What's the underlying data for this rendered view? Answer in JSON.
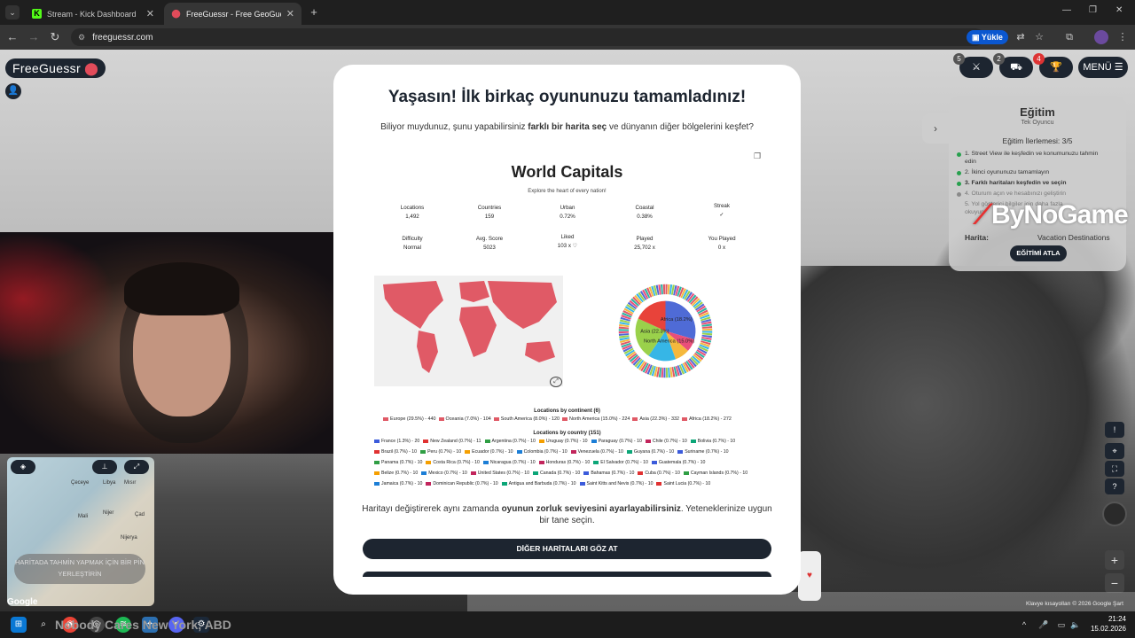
{
  "browser": {
    "tabs": [
      {
        "label": "Stream - Kick Dashboard",
        "icon": "kick-icon",
        "active": false
      },
      {
        "label": "FreeGuessr - Free GeoGuessr Al",
        "icon": "freeguessr-pin-icon",
        "active": true
      }
    ],
    "url": "freeguessr.com",
    "translate_label": "Yükle"
  },
  "game": {
    "logo": "FreeGuessr",
    "badges": {
      "multiplayer": "5",
      "party": "2",
      "trophy": "4"
    },
    "menu_label": "MENÜ",
    "credits": "Klavye kısayolları  © 2026 Google  Şart"
  },
  "tutorial": {
    "title": "Eğitim",
    "subtitle": "Tek Oyuncu",
    "progress": "Eğitim İlerlemesi: 3/5",
    "steps": [
      "1. Street View ile keşfedin ve konumunuzu tahmin edin",
      "2. İkinci oyununuzu tamamlayın",
      "3. Farklı haritaları keşfedin ve seçin",
      "4. Oturum açın ve hesabınızı geliştirin",
      "5. Yol gösterici bilgiler için daha fazla okuyun"
    ],
    "map_label": "Harita:",
    "map_value": "Vacation Destinations",
    "skip_label": "EĞİTİMİ ATLA"
  },
  "overlay_brand": "ByNoGame",
  "minimap": {
    "place_button": "HARİTADA TAHMİN YAPMAK İÇİN BİR PİN YERLEŞTİRİN",
    "google": "Google",
    "labels": [
      "Çeceye",
      "Libya",
      "Mısır",
      "Nijer",
      "Çad",
      "Mali",
      "Nijerya"
    ]
  },
  "modal": {
    "title": "Yaşasın! İlk birkaç oyununuzu tamamladınız!",
    "hint_pre": "Biliyor muydunuz, şunu yapabilirsiniz ",
    "hint_bold": "farklı bir harita seç",
    "hint_post": " ve dünyanın diğer bölgelerini keşfet?",
    "difficulty_pre": "Haritayı değiştirerek aynı zamanda ",
    "difficulty_bold": "oyunun zorluk seviyesini ayarlayabilirsiniz",
    "difficulty_post": ". Yeteneklerinize uygun bir tane seçin.",
    "browse_button": "DİĞER HARİTALARI GÖZ AT"
  },
  "map_card": {
    "title": "World Capitals",
    "subtitle": "Explore the heart of every nation!",
    "stats_row1": [
      {
        "label": "Locations",
        "value": "1,492"
      },
      {
        "label": "Countries",
        "value": "159"
      },
      {
        "label": "Urban",
        "value": "0.72%"
      },
      {
        "label": "Coastal",
        "value": "0.38%"
      },
      {
        "label": "Streak",
        "value": "✓"
      }
    ],
    "stats_row2": [
      {
        "label": "Difficulty",
        "value": "Normal"
      },
      {
        "label": "Avg. Score",
        "value": "5023"
      },
      {
        "label": "Liked",
        "value": "103 x ♡"
      },
      {
        "label": "Played",
        "value": "25,702 x"
      },
      {
        "label": "You Played",
        "value": "0 x"
      }
    ],
    "continents_title": "Locations by continent (6)",
    "continents": [
      "Europe (29.5%) - 440",
      "Oceania (7.0%) - 104",
      "South America (8.0%) - 120",
      "North America (15.0%) - 224",
      "Asia (22.3%) - 332",
      "Africa (18.2%) - 272"
    ],
    "countries_title": "Locations by country (151)",
    "countries": [
      [
        "France (1.3%) - 20",
        "New Zealand (0.7%) - 11",
        "Argentina (0.7%) - 10",
        "Uruguay (0.7%) - 10",
        "Paraguay (0.7%) - 10",
        "Chile (0.7%) - 10",
        "Bolivia (0.7%) - 10"
      ],
      [
        "Brazil (0.7%) - 10",
        "Peru (0.7%) - 10",
        "Ecuador (0.7%) - 10",
        "Colombia (0.7%) - 10",
        "Venezuela (0.7%) - 10",
        "Guyana (0.7%) - 10",
        "Suriname (0.7%) - 10"
      ],
      [
        "Panama (0.7%) - 10",
        "Costa Rica (0.7%) - 10",
        "Nicaragua (0.7%) - 10",
        "Honduras (0.7%) - 10",
        "El Salvador (0.7%) - 10",
        "Guatemala (0.7%) - 10"
      ],
      [
        "Belize (0.7%) - 10",
        "Mexico (0.7%) - 10",
        "United States (0.7%) - 10",
        "Canada (0.7%) - 10",
        "Bahamas (0.7%) - 10",
        "Cuba (0.7%) - 10",
        "Cayman Islands (0.7%) - 10"
      ],
      [
        "Jamaica (0.7%) - 10",
        "Dominican Republic (0.7%) - 10",
        "Antigua and Barbuda (0.7%) - 10",
        "Saint Kitts and Nevis (0.7%) - 10",
        "Saint Lucia (0.7%) - 10"
      ]
    ],
    "donut_labels": [
      "Africa (18.2%)",
      "Asia (22.3%)",
      "North America (15.0%)"
    ]
  },
  "chart_data": {
    "type": "pie",
    "categories": [
      "Europe",
      "Oceania",
      "South America",
      "North America",
      "Asia",
      "Africa"
    ],
    "values": [
      29.5,
      7.0,
      8.0,
      15.0,
      22.3,
      18.2
    ],
    "colors": [
      "#4f6bd6",
      "#e94f7a",
      "#f5b83d",
      "#36b6e6",
      "#9ad14b",
      "#e8433a"
    ]
  },
  "taskbar": {
    "stream_text": "Nobody Cares New York, ABD",
    "time": "21:24",
    "date": "15.02.2026"
  }
}
